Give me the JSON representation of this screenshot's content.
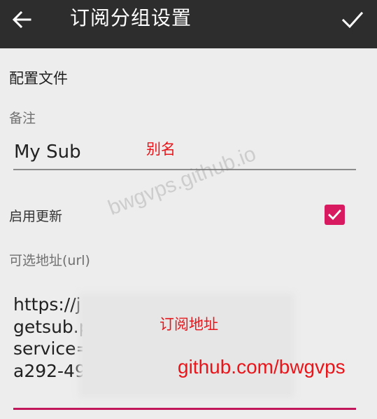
{
  "header": {
    "title": "订阅分组设置",
    "back_icon": "arrow-left-icon",
    "confirm_icon": "check-icon",
    "background": "#2d2d2d"
  },
  "section": {
    "title": "配置文件"
  },
  "remark": {
    "label": "备注",
    "value": "My Sub"
  },
  "auto_update": {
    "label": "启用更新",
    "checked": true,
    "accent": "#d81b60"
  },
  "url": {
    "label": "可选地址(url)",
    "lines": [
      "https://j",
      "getsub.p",
      "service=",
      "a292-49"
    ]
  },
  "annotations": {
    "alias": "别名",
    "sub_url": "订阅地址",
    "site": "github.com/bwgvps",
    "color": "#e8161b"
  },
  "watermark": "bwgvps.github.io"
}
